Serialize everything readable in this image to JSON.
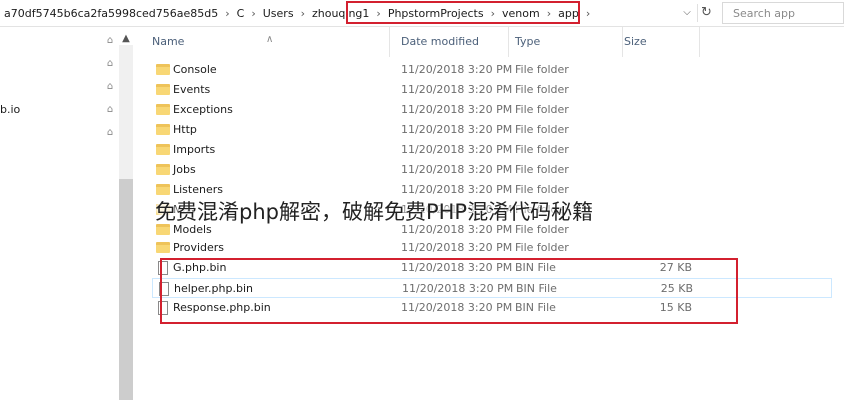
{
  "address": {
    "segments": [
      "a70df5745b6ca2fa5998ced756ae85d5",
      "C",
      "Users",
      "zhouqing1",
      "PhpstormProjects",
      "venom",
      "app"
    ],
    "separator": "›",
    "dropdown_icon": "chevron-down-icon",
    "refresh_icon": "refresh-icon"
  },
  "search": {
    "placeholder": "Search app"
  },
  "nav": {
    "items": [
      "b.io"
    ]
  },
  "columns": {
    "name": "Name",
    "date": "Date modified",
    "type": "Type",
    "size": "Size"
  },
  "files": [
    {
      "name": "Console",
      "date": "11/20/2018 3:20 PM",
      "type": "File folder",
      "size": "",
      "kind": "folder"
    },
    {
      "name": "Events",
      "date": "11/20/2018 3:20 PM",
      "type": "File folder",
      "size": "",
      "kind": "folder"
    },
    {
      "name": "Exceptions",
      "date": "11/20/2018 3:20 PM",
      "type": "File folder",
      "size": "",
      "kind": "folder"
    },
    {
      "name": "Http",
      "date": "11/20/2018 3:20 PM",
      "type": "File folder",
      "size": "",
      "kind": "folder"
    },
    {
      "name": "Imports",
      "date": "11/20/2018 3:20 PM",
      "type": "File folder",
      "size": "",
      "kind": "folder"
    },
    {
      "name": "Jobs",
      "date": "11/20/2018 3:20 PM",
      "type": "File folder",
      "size": "",
      "kind": "folder"
    },
    {
      "name": "Listeners",
      "date": "11/20/2018 3:20 PM",
      "type": "File folder",
      "size": "",
      "kind": "folder"
    },
    {
      "name": "Mail",
      "date": "11/20/2018 3:20 PM",
      "type": "File folder",
      "size": "",
      "kind": "folder"
    },
    {
      "name": "Models",
      "date": "11/20/2018 3:20 PM",
      "type": "File folder",
      "size": "",
      "kind": "folder"
    },
    {
      "name": "Providers",
      "date": "11/20/2018 3:20 PM",
      "type": "File folder",
      "size": "",
      "kind": "folder"
    },
    {
      "name": "G.php.bin",
      "date": "11/20/2018 3:20 PM",
      "type": "BIN File",
      "size": "27 KB",
      "kind": "file"
    },
    {
      "name": "helper.php.bin",
      "date": "11/20/2018 3:20 PM",
      "type": "BIN File",
      "size": "25 KB",
      "kind": "file"
    },
    {
      "name": "Response.php.bin",
      "date": "11/20/2018 3:20 PM",
      "type": "BIN File",
      "size": "15 KB",
      "kind": "file"
    }
  ],
  "overlay": {
    "caption": "免费混淆php解密，破解免费PHP混淆代码秘籍"
  },
  "colors": {
    "highlight": "#d3202f",
    "folder": "#f8d775",
    "header_text": "#4c607a",
    "selection": "#cce8ff"
  }
}
